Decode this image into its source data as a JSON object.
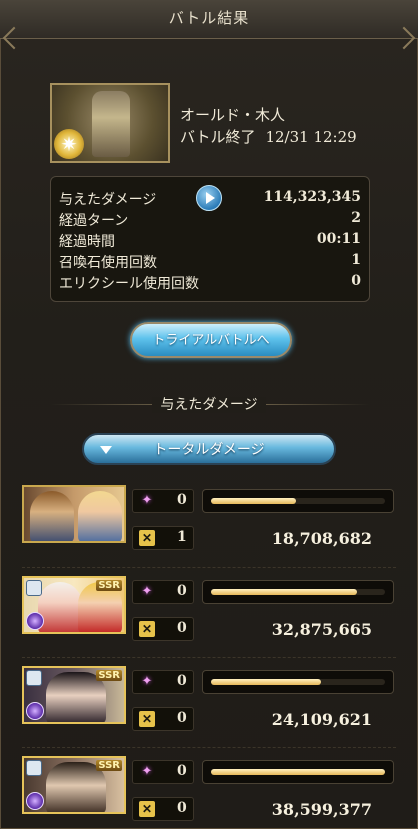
{
  "header": {
    "title": "バトル結果"
  },
  "boss": {
    "name": "オールド・木人",
    "end_label": "バトル終了",
    "end_time": "12/31 12:29"
  },
  "stats": [
    {
      "label": "与えたダメージ",
      "value": "114,323,345"
    },
    {
      "label": "経過ターン",
      "value": "2"
    },
    {
      "label": "経過時間",
      "value": "00:11"
    },
    {
      "label": "召喚石使用回数",
      "value": "1"
    },
    {
      "label": "エリクシール使用回数",
      "value": "0"
    }
  ],
  "trial_button": {
    "label": "トライアルバトルへ"
  },
  "damage_section": {
    "title": "与えたダメージ"
  },
  "total_damage_button": {
    "label": "トータルダメージ"
  },
  "members": [
    {
      "portrait_icon": "party-portrait-icon",
      "rarity": "",
      "skill_count": "0",
      "ougi_count": "1",
      "damage": "18,708,682",
      "share": 0.49
    },
    {
      "portrait_icon": "party-portrait-icon",
      "rarity": "SSR",
      "skill_count": "0",
      "ougi_count": "0",
      "damage": "32,875,665",
      "share": 0.84
    },
    {
      "portrait_icon": "party-portrait-icon",
      "rarity": "SSR",
      "skill_count": "0",
      "ougi_count": "0",
      "damage": "24,109,621",
      "share": 0.63
    },
    {
      "portrait_icon": "party-portrait-icon",
      "rarity": "SSR",
      "skill_count": "0",
      "ougi_count": "0",
      "damage": "38,599,377",
      "share": 1.0
    }
  ],
  "colors": {
    "accent_blue": "#5ec2ec",
    "gold": "#e6b85a",
    "background": "#221f1a"
  }
}
